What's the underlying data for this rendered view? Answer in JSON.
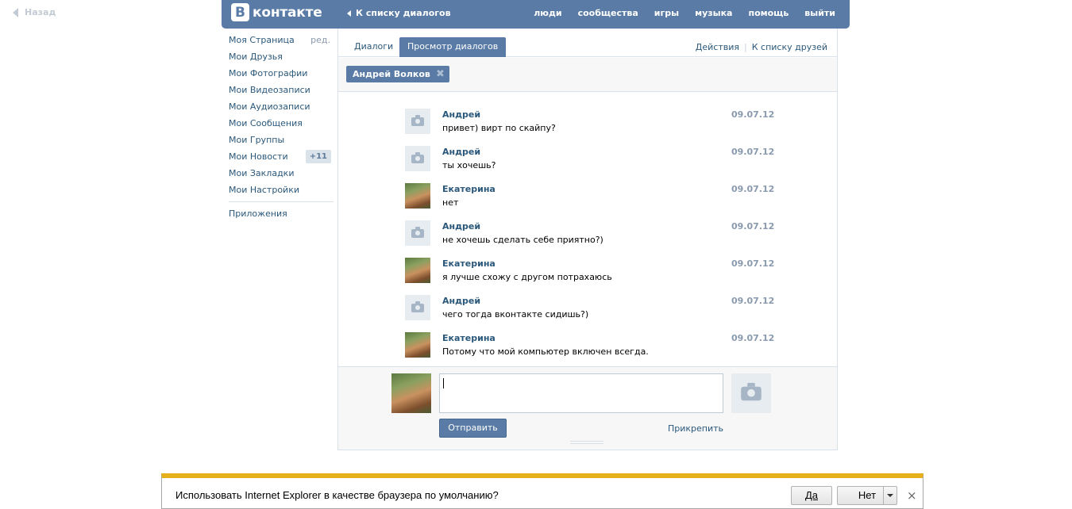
{
  "back_link": "Назад",
  "topbar": {
    "logo_letter": "В",
    "logo_text": "контакте",
    "back_to_dialogs": "К списку диалогов",
    "nav": [
      "люди",
      "сообщества",
      "игры",
      "музыка",
      "помощь",
      "выйти"
    ]
  },
  "sidebar": {
    "items": [
      {
        "label": "Моя Страница",
        "extra": "ред."
      },
      {
        "label": "Мои Друзья"
      },
      {
        "label": "Мои Фотографии"
      },
      {
        "label": "Мои Видеозаписи"
      },
      {
        "label": "Мои Аудиозаписи"
      },
      {
        "label": "Мои Сообщения"
      },
      {
        "label": "Мои Группы"
      },
      {
        "label": "Мои Новости",
        "badge": "+11"
      },
      {
        "label": "Мои Закладки"
      },
      {
        "label": "Мои Настройки"
      }
    ],
    "apps": "Приложения"
  },
  "tabs": {
    "dialogs": "Диалоги",
    "view": "Просмотр диалогов",
    "actions": "Действия",
    "separator": "|",
    "to_friends": "К списку друзей"
  },
  "filter_chip": "Андрей Волков",
  "messages": [
    {
      "name": "Андрей",
      "date": "09.07.12",
      "text": "привет) вирт по скайпу?",
      "avatar": "camera-placeholder"
    },
    {
      "name": "Андрей",
      "date": "09.07.12",
      "text": "ты хочешь?",
      "avatar": "camera-placeholder"
    },
    {
      "name": "Екатерина",
      "date": "09.07.12",
      "text": "нет",
      "avatar": "photo"
    },
    {
      "name": "Андрей",
      "date": "09.07.12",
      "text": "не хочешь сделать себе приятно?)",
      "avatar": "camera-placeholder"
    },
    {
      "name": "Екатерина",
      "date": "09.07.12",
      "text": "я лучше схожу с другом потрахаюсь",
      "avatar": "photo"
    },
    {
      "name": "Андрей",
      "date": "09.07.12",
      "text": "чего тогда вконтакте сидишь?)",
      "avatar": "camera-placeholder"
    },
    {
      "name": "Екатерина",
      "date": "09.07.12",
      "text": "Потому что мой компьютер включен всегда.",
      "avatar": "photo"
    }
  ],
  "compose": {
    "value": "",
    "send": "Отправить",
    "attach": "Прикрепить"
  },
  "ie_bar": {
    "text": "Использовать Internet Explorer в качестве браузера по умолчанию?",
    "yes": "Да",
    "no": "Нет",
    "close": "×"
  },
  "colors": {
    "brand": "#597ba5",
    "link": "#2b587a",
    "muted": "#8a9aae",
    "ie_accent": "#e5b01a"
  }
}
